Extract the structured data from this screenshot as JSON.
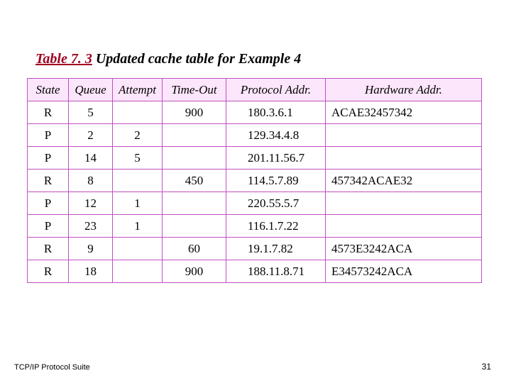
{
  "caption": {
    "tnum": "Table 7. 3",
    "rest": "  Updated cache table for Example 4"
  },
  "headers": {
    "state": "State",
    "queue": "Queue",
    "attempt": "Attempt",
    "timeout": "Time-Out",
    "proto": "Protocol Addr.",
    "hw": "Hardware Addr."
  },
  "rows": [
    {
      "state": "R",
      "queue": "5",
      "attempt": "",
      "timeout": "900",
      "proto": "180.3.6.1",
      "hw": "ACAE32457342"
    },
    {
      "state": "P",
      "queue": "2",
      "attempt": "2",
      "timeout": "",
      "proto": "129.34.4.8",
      "hw": ""
    },
    {
      "state": "P",
      "queue": "14",
      "attempt": "5",
      "timeout": "",
      "proto": "201.11.56.7",
      "hw": ""
    },
    {
      "state": "R",
      "queue": "8",
      "attempt": "",
      "timeout": "450",
      "proto": "114.5.7.89",
      "hw": "457342ACAE32"
    },
    {
      "state": "P",
      "queue": "12",
      "attempt": "1",
      "timeout": "",
      "proto": "220.55.5.7",
      "hw": ""
    },
    {
      "state": "P",
      "queue": "23",
      "attempt": "1",
      "timeout": "",
      "proto": "116.1.7.22",
      "hw": ""
    },
    {
      "state": "R",
      "queue": "9",
      "attempt": "",
      "timeout": "60",
      "proto": "19.1.7.82",
      "hw": "4573E3242ACA"
    },
    {
      "state": "R",
      "queue": "18",
      "attempt": "",
      "timeout": "900",
      "proto": "188.11.8.71",
      "hw": "E34573242ACA"
    }
  ],
  "footer": {
    "left": "TCP/IP Protocol Suite",
    "right": "31"
  }
}
